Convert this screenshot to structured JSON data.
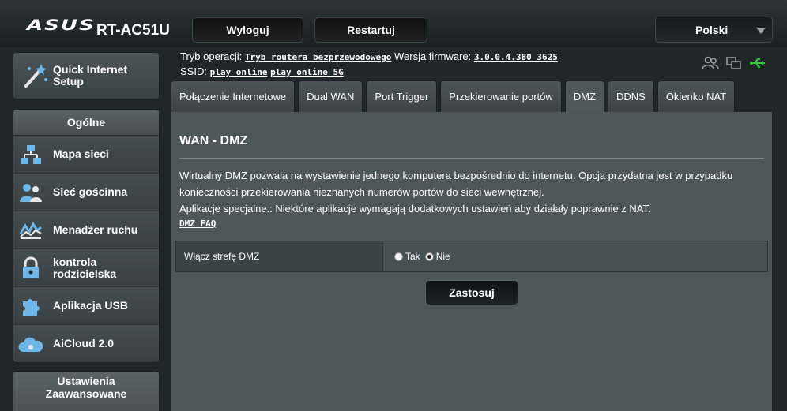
{
  "header": {
    "brand": "ASUS",
    "model": "RT-AC51U",
    "logout_label": "Wyloguj",
    "restart_label": "Restartuj",
    "language": "Polski"
  },
  "sidebar": {
    "quick_setup": "Quick Internet Setup",
    "general_heading": "Ogólne",
    "items": [
      {
        "label": "Mapa sieci",
        "icon": "network-map-icon"
      },
      {
        "label": "Sieć gościnna",
        "icon": "guest-network-icon"
      },
      {
        "label": "Menadżer ruchu",
        "icon": "traffic-manager-icon"
      },
      {
        "label": "kontrola rodzicielska",
        "icon": "parental-control-lock-icon"
      },
      {
        "label": "Aplikacja USB",
        "icon": "usb-app-puzzle-icon"
      },
      {
        "label": "AiCloud 2.0",
        "icon": "aicloud-icon"
      }
    ],
    "advanced_heading": "Ustawienia Zaawansowane"
  },
  "info": {
    "mode_label": "Tryb operacji:",
    "mode_value": "Tryb routera bezprzewodowego",
    "firmware_label": "Wersja firmware:",
    "firmware_value": "3.0.0.4.380_3625",
    "ssid_label": "SSID:",
    "ssid_1": "play_online",
    "ssid_2": "play_online_5G"
  },
  "tabs": [
    {
      "label": "Połączenie Internetowe",
      "active": false
    },
    {
      "label": "Dual WAN",
      "active": false
    },
    {
      "label": "Port Trigger",
      "active": false
    },
    {
      "label": "Przekierowanie portów",
      "active": false
    },
    {
      "label": "DMZ",
      "active": true
    },
    {
      "label": "DDNS",
      "active": false
    },
    {
      "label": "Okienko NAT",
      "active": false
    }
  ],
  "panel": {
    "title": "WAN - DMZ",
    "desc_1": "Wirtualny DMZ pozwala na wystawienie jednego komputera bezpośrednio do internetu. Opcja przydatna jest w przypadku konieczności przekierowania nieznanych numerów portów do sieci wewnętrznej.",
    "desc_2": "Aplikacje specjalne.: Niektóre aplikacje wymagają dodatkowych ustawień aby działały poprawnie z NAT.",
    "faq_link": "DMZ FAQ",
    "dmz_label": "Włącz strefę DMZ",
    "option_yes": "Tak",
    "option_no": "Nie",
    "selected": "Nie",
    "apply_label": "Zastosuj"
  },
  "colors": {
    "background": "#1f2729",
    "panel": "#4d5658",
    "usb_status": "#2ecc40"
  }
}
